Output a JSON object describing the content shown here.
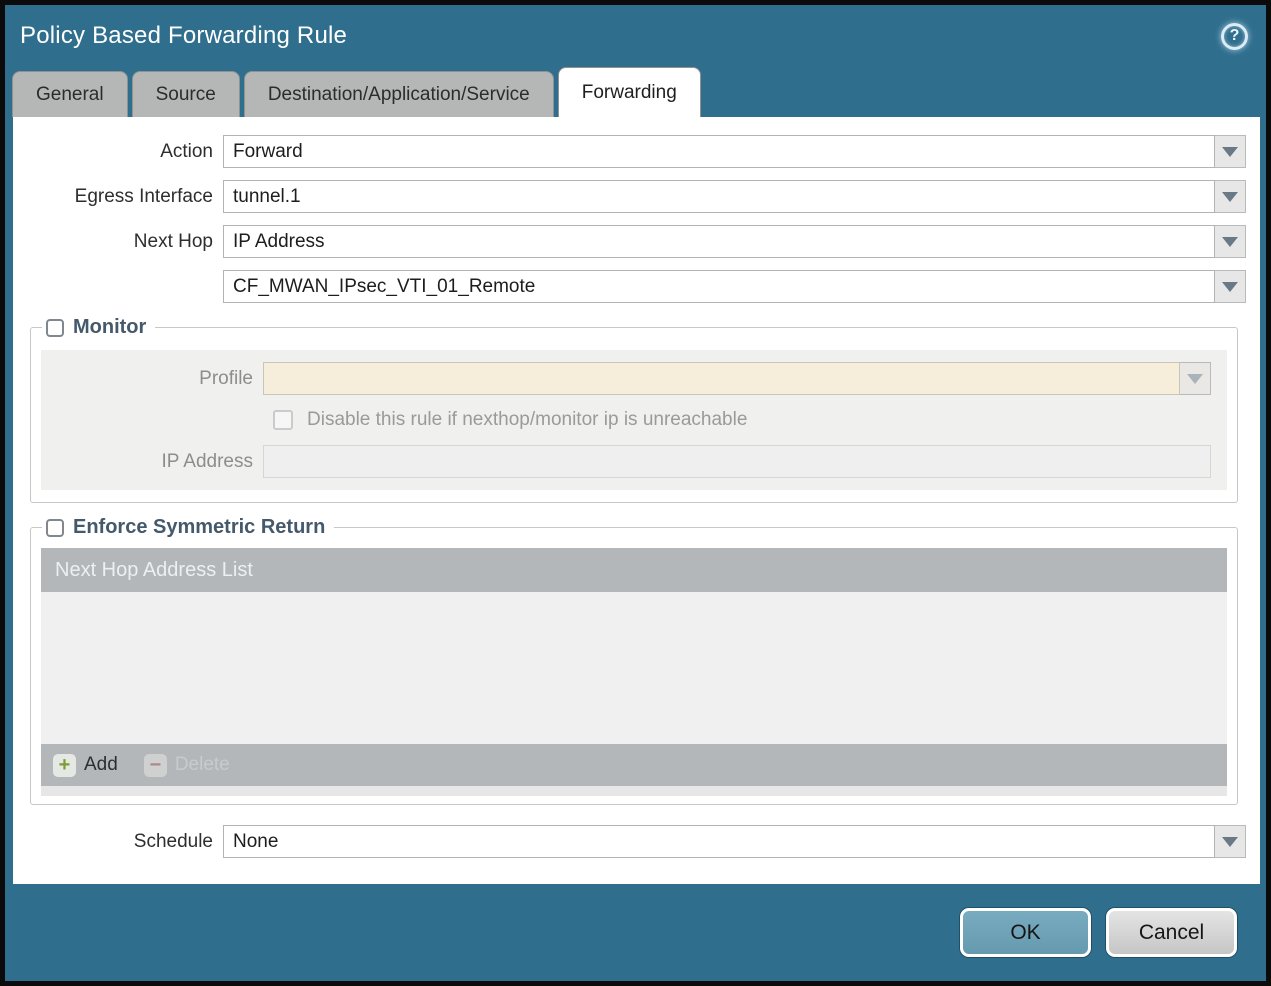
{
  "window": {
    "title": "Policy Based Forwarding Rule",
    "help_glyph": "?"
  },
  "tabs": [
    {
      "label": "General",
      "active": false
    },
    {
      "label": "Source",
      "active": false
    },
    {
      "label": "Destination/Application/Service",
      "active": false
    },
    {
      "label": "Forwarding",
      "active": true
    }
  ],
  "form": {
    "action": {
      "label": "Action",
      "value": "Forward"
    },
    "egress_interface": {
      "label": "Egress Interface",
      "value": "tunnel.1"
    },
    "next_hop": {
      "label": "Next Hop",
      "value": "IP Address"
    },
    "next_hop_address": {
      "value": "CF_MWAN_IPsec_VTI_01_Remote"
    },
    "schedule": {
      "label": "Schedule",
      "value": "None"
    }
  },
  "monitor": {
    "title": "Monitor",
    "checked": false,
    "profile": {
      "label": "Profile",
      "value": ""
    },
    "disable_rule": {
      "label": "Disable this rule if nexthop/monitor ip is unreachable",
      "checked": false
    },
    "ip_address": {
      "label": "IP Address",
      "value": ""
    }
  },
  "symmetric_return": {
    "title": "Enforce Symmetric Return",
    "checked": false,
    "table": {
      "header": "Next Hop Address List",
      "rows": []
    },
    "add_label": "Add",
    "delete_label": "Delete",
    "add_glyph": "+",
    "delete_glyph": "−",
    "delete_enabled": false
  },
  "footer": {
    "ok_label": "OK",
    "cancel_label": "Cancel"
  },
  "colors": {
    "chrome_teal": "#2f6e8d",
    "window_border": "#0b0b0b",
    "inactive_tab": "#b5b6b6",
    "active_tab": "#ffffff",
    "group_title_text": "#44596b",
    "disabled_field_beige": "#f6eedb",
    "table_header_gray": "#b3b7ba",
    "add_icon_green": "#7e9c35",
    "delete_icon_red": "#a85f63",
    "ok_button_blue": "#6fa3b8",
    "cancel_button_gray": "#cfcfcf"
  }
}
